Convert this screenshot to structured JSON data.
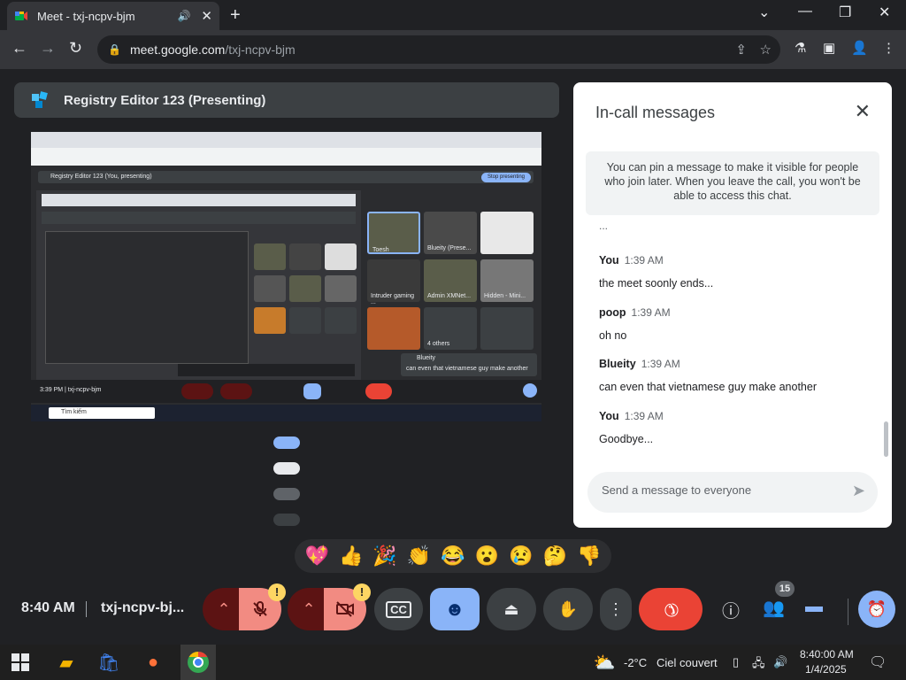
{
  "browser": {
    "tab_title": "Meet - txj-ncpv-bjm",
    "url_domain": "meet.google.com",
    "url_path": "/txj-ncpv-bjm"
  },
  "presenting": {
    "title": "Registry Editor 123 (Presenting)",
    "shared": {
      "inner_title": "Registry Editor 123 (You, presenting)",
      "stop_label": "Stop presenting",
      "time_code": "3:39 PM  |  txj-ncpv-bjm",
      "tiles": [
        "Toesh",
        "Blueity (Prese...",
        "",
        "Intruder gaming ...",
        "Admin XMNet...",
        "Hidden - Mini...",
        "",
        "4 others",
        ""
      ],
      "caption_name": "Blueity",
      "caption_text": "can even that vietnamese guy make another",
      "search_text": "Tìm kiếm"
    }
  },
  "reactions": [
    "💖",
    "👍",
    "🎉",
    "👏",
    "😂",
    "😮",
    "😢",
    "🤔",
    "👎"
  ],
  "chat": {
    "title": "In-call messages",
    "note": "You can pin a message to make it visible for people who join later. When you leave the call, you won't be able to access this chat.",
    "ellipsis": "...",
    "messages": [
      {
        "sender": "You",
        "time": "1:39 AM",
        "text": "the meet soonly ends..."
      },
      {
        "sender": "poop",
        "time": "1:39 AM",
        "text": "oh no"
      },
      {
        "sender": "Blueity",
        "time": "1:39 AM",
        "text": "can even that vietnamese guy make another"
      },
      {
        "sender": "You",
        "time": "1:39 AM",
        "text": "Goodbye..."
      }
    ],
    "input_placeholder": "Send a message to everyone"
  },
  "controls": {
    "time": "8:40 AM",
    "meeting_code": "txj-ncpv-bj...",
    "warning_badge": "!",
    "people_count": "15"
  },
  "taskbar": {
    "temperature": "-2°C",
    "weather": "Ciel couvert",
    "time": "8:40:00 AM",
    "date": "1/4/2025"
  },
  "colors": {
    "end_call": "#ea4335",
    "muted_button": "#f28b82",
    "accent_blue": "#8ab4f8",
    "dark_red": "#5c1313",
    "warning": "#fdd663"
  }
}
